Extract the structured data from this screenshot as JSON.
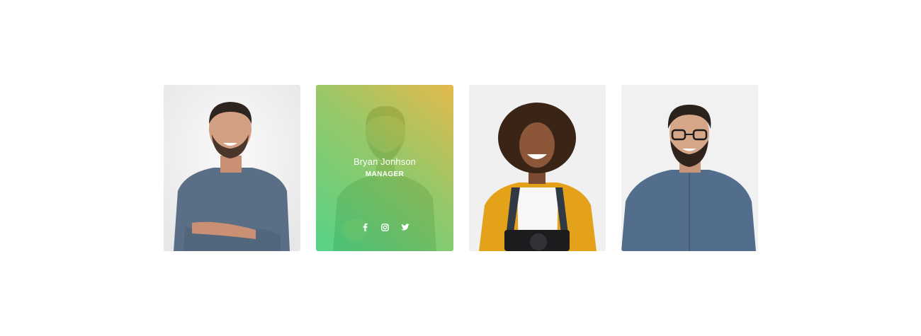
{
  "colors": {
    "gradient_start": "#45d07c",
    "gradient_mid": "#8cc45a",
    "gradient_end": "#e3b43a",
    "card_background": "#f1f1f2",
    "text_on_overlay": "#ffffff"
  },
  "team": {
    "members": [
      {
        "photo": "man-crossed-arms-gray-shirt"
      },
      {
        "photo": "man-pointing",
        "name": "Bryan Jonhson",
        "role": "MANAGER",
        "socials": [
          "facebook-icon",
          "instagram-icon",
          "twitter-icon"
        ]
      },
      {
        "photo": "woman-yellow-cardigan-camera"
      },
      {
        "photo": "man-glasses-denim-shirt"
      }
    ]
  }
}
